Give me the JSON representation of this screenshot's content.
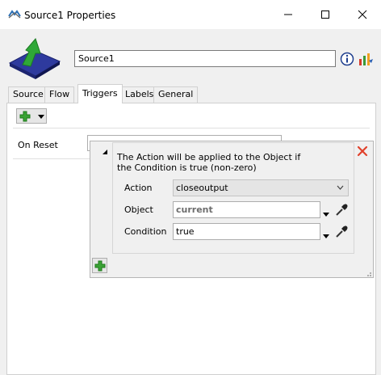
{
  "window": {
    "title": "Source1  Properties"
  },
  "header": {
    "object_name": "Source1"
  },
  "tabs": [
    {
      "label": "Source"
    },
    {
      "label": "Flow"
    },
    {
      "label": "Triggers"
    },
    {
      "label": "Labels"
    },
    {
      "label": "General"
    }
  ],
  "active_tab": "Triggers",
  "triggers": {
    "on_reset_label": "On Reset"
  },
  "popup": {
    "description": "The Action will be applied to the Object if the Condition is true (non-zero)",
    "action_label": "Action",
    "action_value": "closeoutput",
    "object_label": "Object",
    "object_value": "current",
    "condition_label": "Condition",
    "condition_value": "true"
  },
  "colors": {
    "close_x": "#e0412b",
    "plus_green": "#3aa335"
  }
}
